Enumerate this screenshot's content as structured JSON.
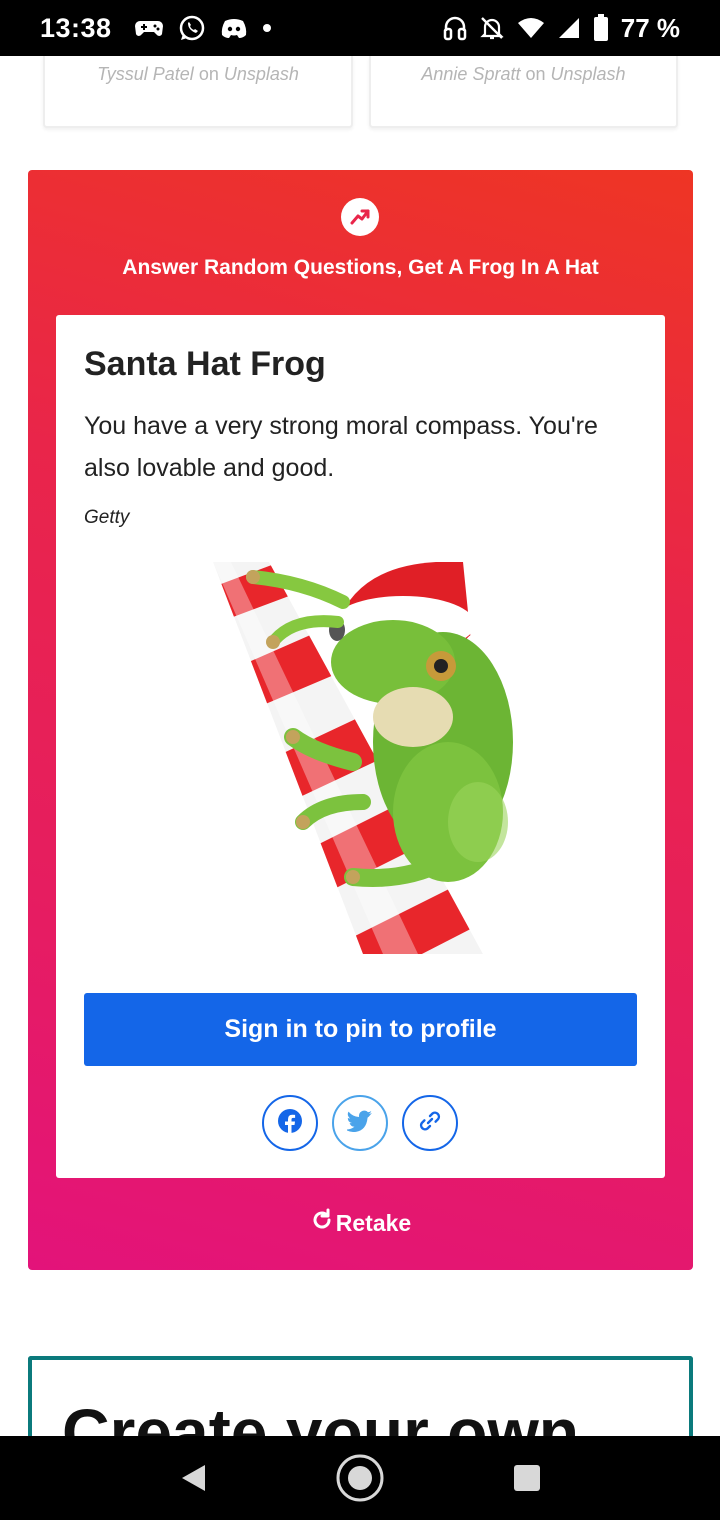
{
  "status_bar": {
    "time": "13:38",
    "battery": "77 %"
  },
  "credits": [
    {
      "author": "Tyssul Patel",
      "on": "on",
      "source": "Unsplash"
    },
    {
      "author": "Annie Spratt",
      "on": "on",
      "source": "Unsplash"
    }
  ],
  "quiz": {
    "title": "Answer Random Questions, Get A Frog In A Hat",
    "accent_color": "#e9254a"
  },
  "result": {
    "heading": "Santa Hat Frog",
    "description": "You have a very strong moral compass. You're also lovable and good.",
    "image_credit": "Getty"
  },
  "actions": {
    "pin_label": "Sign in to pin to profile",
    "retake_label": "Retake",
    "pin_color": "#1466e8"
  },
  "create": {
    "title": "Create your own"
  },
  "icons": {
    "trending": "trending-icon",
    "facebook": "facebook-icon",
    "twitter": "twitter-icon",
    "link": "link-icon",
    "retake": "refresh-icon"
  }
}
